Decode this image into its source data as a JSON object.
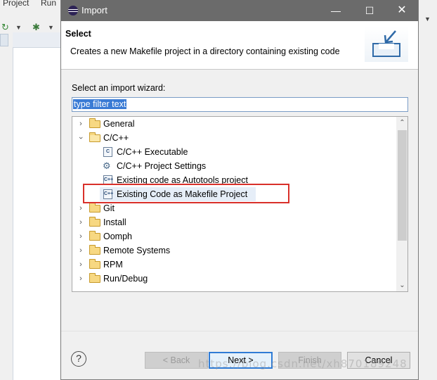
{
  "background": {
    "menu": [
      "Project",
      "Run"
    ]
  },
  "dialog": {
    "title": "Import",
    "header_title": "Select",
    "header_description": "Creates a new Makefile project in a directory containing existing code",
    "section_label": "Select an import wizard:",
    "filter_value": "type filter text",
    "tree": [
      {
        "label": "General",
        "kind": "folder",
        "level": 0,
        "expanded": false
      },
      {
        "label": "C/C++",
        "kind": "folder",
        "level": 0,
        "expanded": true
      },
      {
        "label": "C/C++ Executable",
        "kind": "file",
        "level": 1,
        "icon": "c-file-icon"
      },
      {
        "label": "C/C++ Project Settings",
        "kind": "file",
        "level": 1,
        "icon": "gear-settings-icon"
      },
      {
        "label": "Existing code as Autotools project",
        "kind": "file",
        "level": 1,
        "icon": "cpp-file-icon"
      },
      {
        "label": "Existing Code as Makefile Project",
        "kind": "file",
        "level": 1,
        "icon": "cpp-file-icon",
        "selected": true
      },
      {
        "label": "Git",
        "kind": "folder",
        "level": 0,
        "expanded": false
      },
      {
        "label": "Install",
        "kind": "folder",
        "level": 0,
        "expanded": false
      },
      {
        "label": "Oomph",
        "kind": "folder",
        "level": 0,
        "expanded": false
      },
      {
        "label": "Remote Systems",
        "kind": "folder",
        "level": 0,
        "expanded": false
      },
      {
        "label": "RPM",
        "kind": "folder",
        "level": 0,
        "expanded": false
      },
      {
        "label": "Run/Debug",
        "kind": "folder",
        "level": 0,
        "expanded": false
      }
    ],
    "buttons": {
      "help": "?",
      "back": "< Back",
      "next": "Next >",
      "finish": "Finish",
      "cancel": "Cancel"
    }
  },
  "watermark": "https://blog.csdn.net/xh870189248",
  "colors": {
    "titlebar": "#6b6b6b",
    "selection": "#3a7bd5",
    "highlight_border": "#d9302a"
  }
}
